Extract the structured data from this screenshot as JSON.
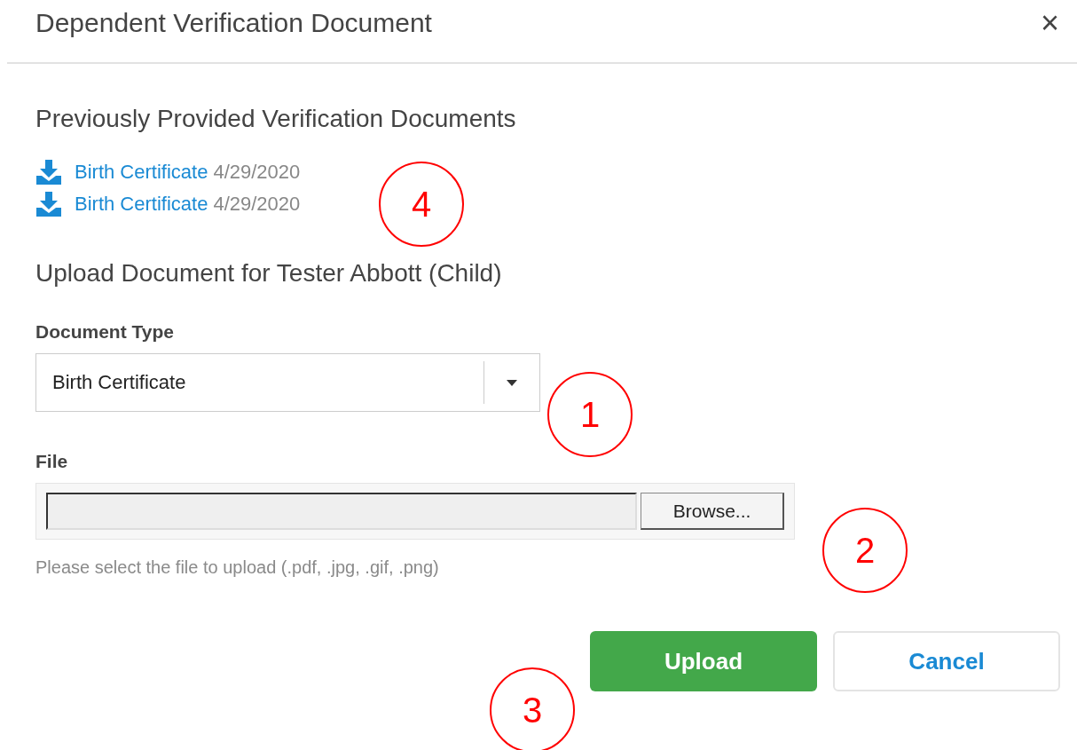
{
  "dialog": {
    "title": "Dependent Verification Document",
    "close": "×"
  },
  "previous": {
    "heading": "Previously Provided Verification Documents",
    "documents": [
      {
        "name": "Birth Certificate",
        "date": "4/29/2020"
      },
      {
        "name": "Birth Certificate",
        "date": "4/29/2020"
      }
    ]
  },
  "upload": {
    "heading": "Upload Document for Tester Abbott (Child)",
    "document_type": {
      "label": "Document Type",
      "value": "Birth Certificate"
    },
    "file": {
      "label": "File",
      "browse": "Browse...",
      "hint": "Please select the file to upload (.pdf, .jpg, .gif, .png)"
    }
  },
  "buttons": [
    {
      "label": "Upload",
      "kind": "primary"
    },
    {
      "label": "Cancel",
      "kind": "secondary"
    }
  ],
  "callouts": [
    {
      "label": "4"
    },
    {
      "label": "1"
    },
    {
      "label": "2"
    },
    {
      "label": "3"
    }
  ]
}
